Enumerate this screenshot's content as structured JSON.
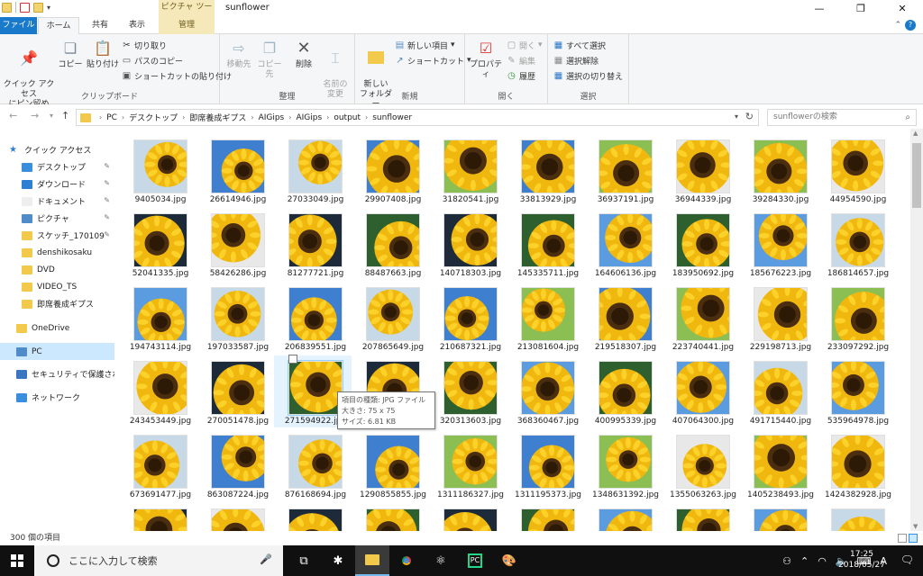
{
  "window": {
    "title": "sunflower",
    "context_tab": "ピクチャ ツール",
    "tabs": [
      "ファイル",
      "ホーム",
      "共有",
      "表示",
      "管理"
    ]
  },
  "ribbon": {
    "clipboard": {
      "label": "クリップボード",
      "pin_quick": "クイック アクセス\nにピン留め",
      "copy": "コピー",
      "paste": "貼り付け",
      "cut": "切り取り",
      "copy_path": "パスのコピー",
      "paste_shortcut": "ショートカットの貼り付け"
    },
    "organize": {
      "label": "整理",
      "move_to": "移動先",
      "copy_to": "コピー先",
      "delete": "削除",
      "rename": "名前の\n変更"
    },
    "new": {
      "label": "新規",
      "new_folder": "新しい\nフォルダー",
      "new_item": "新しい項目",
      "shortcut": "ショートカット"
    },
    "open": {
      "label": "開く",
      "properties": "プロパティ",
      "open": "開く",
      "edit": "編集",
      "history": "履歴"
    },
    "select": {
      "label": "選択",
      "select_all": "すべて選択",
      "select_none": "選択解除",
      "invert": "選択の切り替え"
    }
  },
  "address": {
    "crumbs": [
      "PC",
      "デスクトップ",
      "即席養成ギプス",
      "AIGips",
      "AIGips",
      "output",
      "sunflower"
    ],
    "search_placeholder": "sunflowerの検索"
  },
  "sidebar": {
    "items": [
      {
        "label": "クイック アクセス",
        "icon": "star-icon",
        "pinned": false
      },
      {
        "label": "デスクトップ",
        "icon": "desktop-icon",
        "pinned": true
      },
      {
        "label": "ダウンロード",
        "icon": "download-icon",
        "pinned": true
      },
      {
        "label": "ドキュメント",
        "icon": "document-icon",
        "pinned": true
      },
      {
        "label": "ピクチャ",
        "icon": "picture-icon",
        "pinned": true
      },
      {
        "label": "スケッチ_170109",
        "icon": "folder-icon",
        "pinned": true
      },
      {
        "label": "denshikosaku",
        "icon": "folder-icon",
        "pinned": false
      },
      {
        "label": "DVD",
        "icon": "folder-icon",
        "pinned": false
      },
      {
        "label": "VIDEO_TS",
        "icon": "folder-icon",
        "pinned": false
      },
      {
        "label": "即席養成ギプス",
        "icon": "folder-icon",
        "pinned": false
      },
      {
        "label": "OneDrive",
        "icon": "onedrive-icon",
        "pinned": false
      },
      {
        "label": "PC",
        "icon": "pc-icon",
        "pinned": false
      },
      {
        "label": "セキュリティで保護された",
        "icon": "shield-icon",
        "pinned": false
      },
      {
        "label": "ネットワーク",
        "icon": "network-icon",
        "pinned": false
      }
    ]
  },
  "files": [
    "9405034.jpg",
    "26614946.jpg",
    "27033049.jpg",
    "29907408.jpg",
    "31820541.jpg",
    "33813929.jpg",
    "36937191.jpg",
    "36944339.jpg",
    "39284330.jpg",
    "44954590.jpg",
    "52041335.jpg",
    "58426286.jpg",
    "81277721.jpg",
    "88487663.jpg",
    "140718303.jpg",
    "145335711.jpg",
    "164606136.jpg",
    "183950692.jpg",
    "185676223.jpg",
    "186814657.jpg",
    "194743114.jpg",
    "197033587.jpg",
    "206839551.jpg",
    "207865649.jpg",
    "210687321.jpg",
    "213081604.jpg",
    "219518307.jpg",
    "223740441.jpg",
    "229198713.jpg",
    "233097292.jpg",
    "243453449.jpg",
    "270051478.jpg",
    "271594922.jpg",
    "",
    "320313603.jpg",
    "368360467.jpg",
    "400995339.jpg",
    "407064300.jpg",
    "491715440.jpg",
    "535964978.jpg",
    "673691477.jpg",
    "863087224.jpg",
    "876168694.jpg",
    "1290855855.jpg",
    "1311186327.jpg",
    "1311195373.jpg",
    "1348631392.jpg",
    "1355063263.jpg",
    "1405238493.jpg",
    "1424382928.jpg",
    "",
    "",
    "",
    "",
    "",
    "",
    "",
    "",
    "",
    ""
  ],
  "tooltip": {
    "type": "項目の種類: JPG ファイル",
    "dimensions": "大きさ: 75 x 75",
    "size": "サイズ: 6.81 KB"
  },
  "status": {
    "count": "300 個の項目"
  },
  "taskbar": {
    "search_placeholder": "ここに入力して検索",
    "time": "17:25",
    "date": "2018/05/27",
    "ime": "A"
  },
  "colors": {
    "accent": "#1979ca",
    "selected": "#cce8ff",
    "context": "#f6e9b9",
    "taskbar": "#101010"
  }
}
